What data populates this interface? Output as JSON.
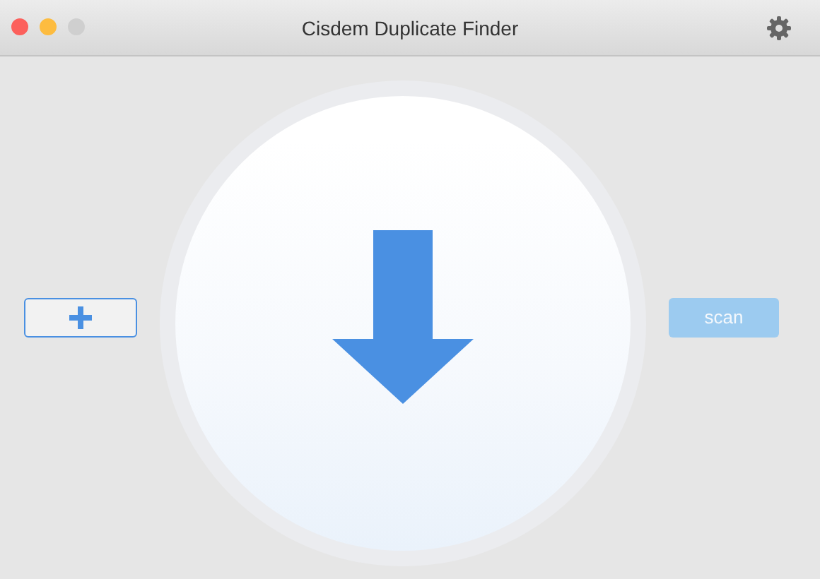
{
  "window": {
    "title": "Cisdem Duplicate Finder",
    "controls": [
      {
        "color": "#fc605c"
      },
      {
        "color": "#fdbc40"
      },
      {
        "color": "#cfcfcf"
      }
    ]
  },
  "add_button": {
    "disabled": false
  },
  "scan_button": {
    "label": "scan",
    "disabled": true
  }
}
